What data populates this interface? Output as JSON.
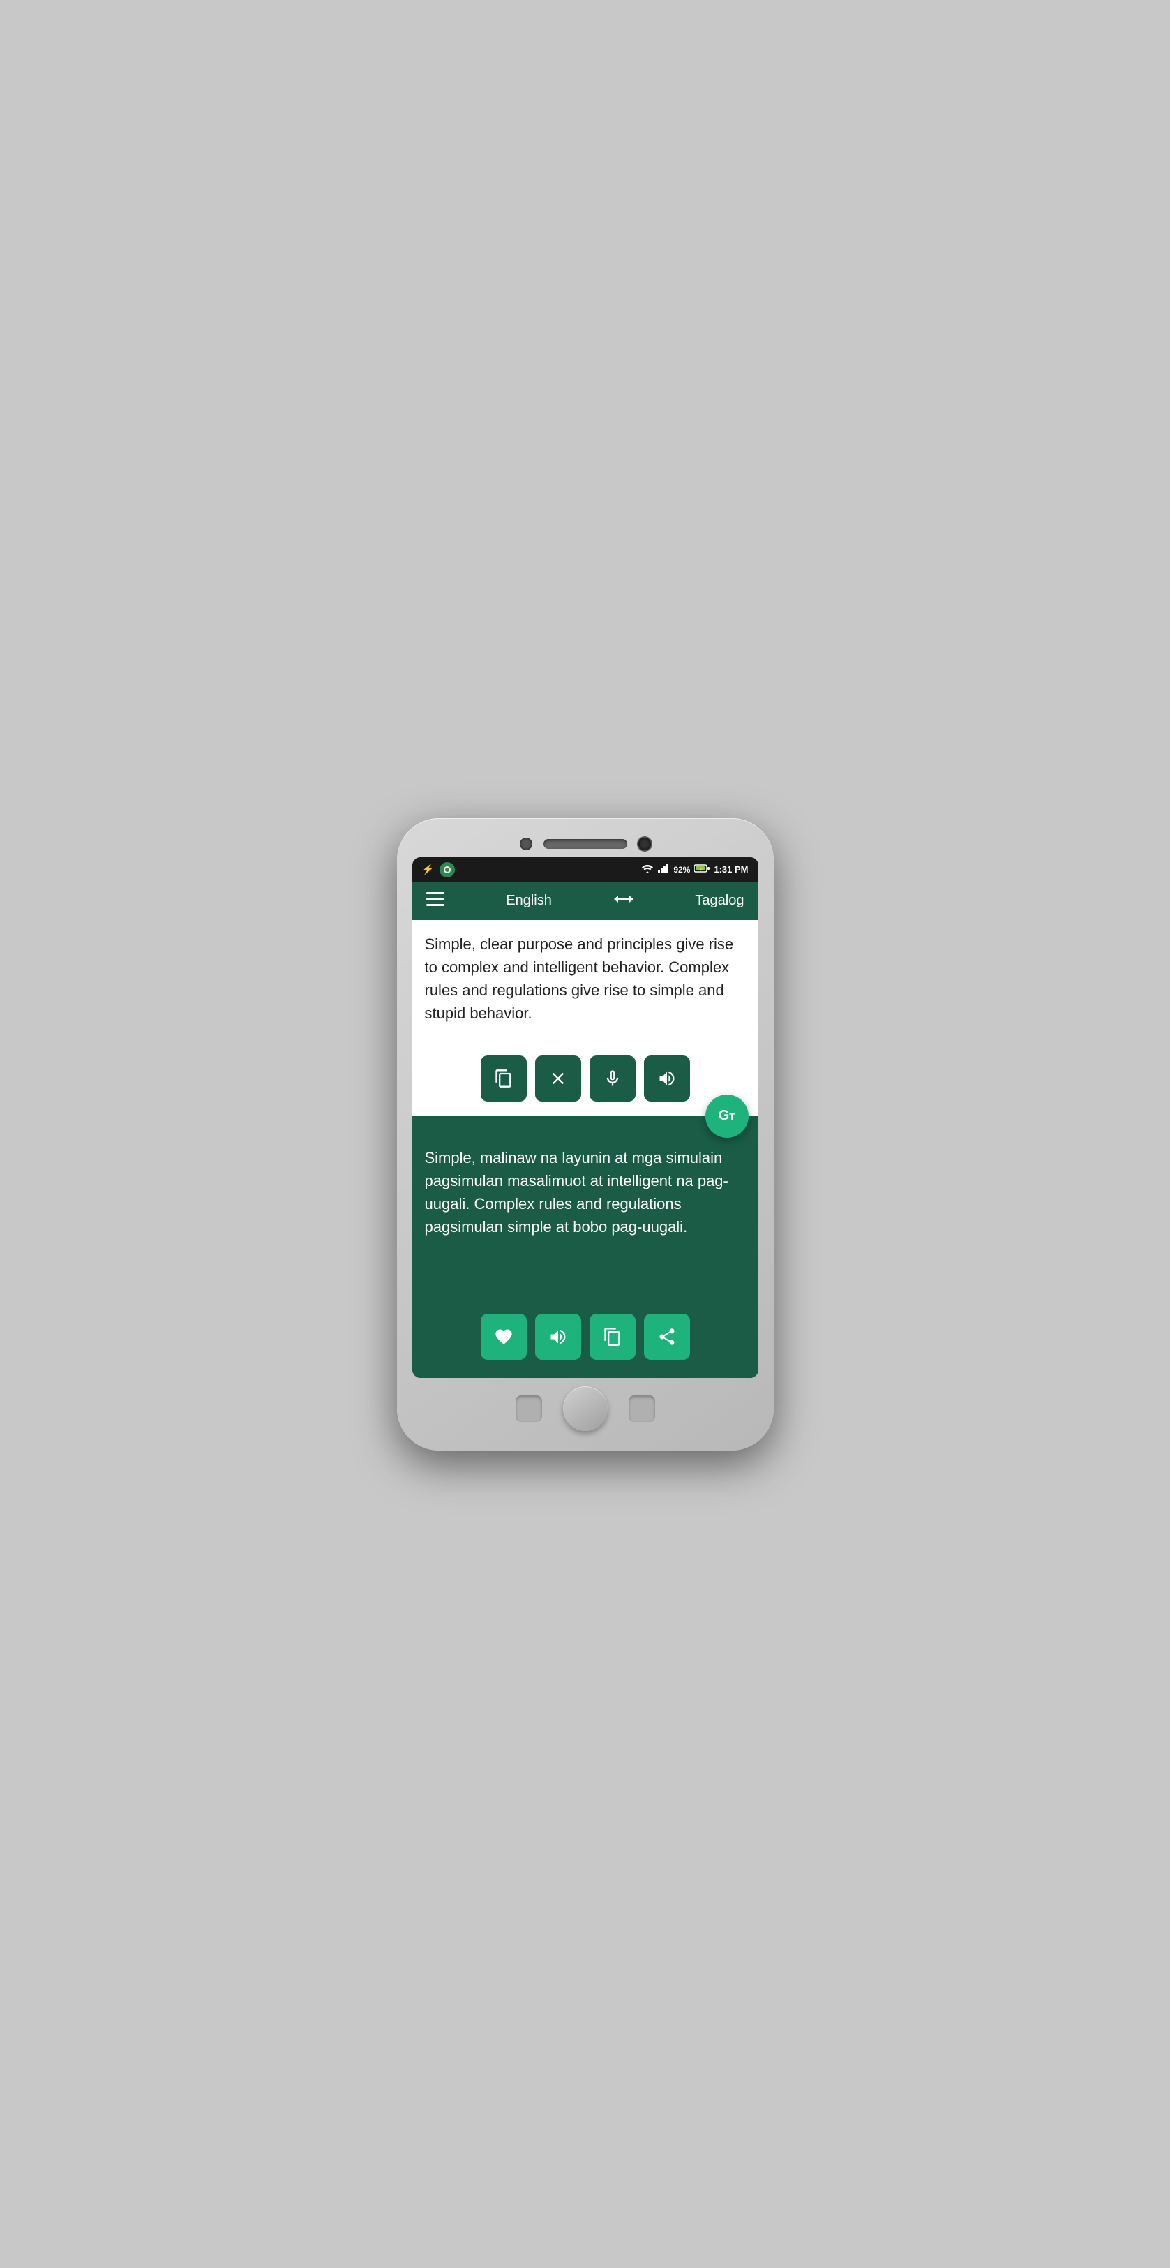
{
  "status_bar": {
    "time": "1:31 PM",
    "battery": "92%",
    "battery_icon": "battery-charging-icon",
    "wifi_icon": "wifi-icon",
    "signal_icon": "signal-icon",
    "usb_icon": "usb-icon",
    "app_icon": "circle-app-icon"
  },
  "header": {
    "menu_icon": "hamburger-icon",
    "lang_from": "English",
    "swap_icon": "swap-icon",
    "lang_to": "Tagalog"
  },
  "input": {
    "source_text": "Simple, clear purpose and principles give rise to complex and intelligent behavior. Complex rules and regulations give rise to simple and stupid behavior.",
    "actions": {
      "clipboard_label": "clipboard-button",
      "clear_label": "clear-button",
      "mic_label": "microphone-button",
      "speaker_label": "speaker-button"
    }
  },
  "translate_fab": {
    "label": "GT",
    "icon": "google-translate-icon"
  },
  "output": {
    "translated_text": "Simple, malinaw na layunin at mga simulain pagsimulan masalimuot at intelligent na pag-uugali. Complex rules and regulations pagsimulan simple at bobo pag-uugali.",
    "actions": {
      "favorite_label": "favorite-button",
      "speaker_label": "speaker-output-button",
      "copy_label": "copy-output-button",
      "share_label": "share-button"
    }
  },
  "colors": {
    "header_bg": "#1a5c46",
    "input_bg": "#ffffff",
    "output_bg": "#1a5c46",
    "action_btn_dark": "#1a5c46",
    "action_btn_teal": "#1eb37d",
    "status_bar_bg": "#1a1a1a"
  }
}
